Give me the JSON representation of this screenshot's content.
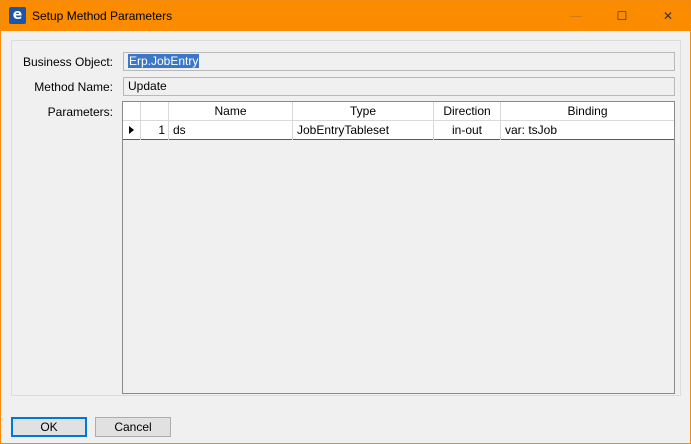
{
  "window": {
    "title": "Setup Method Parameters",
    "app_icon_letter": "e",
    "minimize_glyph": "—",
    "maximize_glyph": "☐",
    "close_glyph": "✕",
    "accent_color": "#fb8c00"
  },
  "form": {
    "business_object_label": "Business Object:",
    "business_object_value": "Erp.JobEntry",
    "method_name_label": "Method Name:",
    "method_name_value": "Update",
    "parameters_label": "Parameters:"
  },
  "grid": {
    "columns": [
      "",
      "",
      "Name",
      "Type",
      "Direction",
      "Binding"
    ],
    "rows": [
      {
        "indicator": "row-selector-arrow-icon",
        "index": "1",
        "name": "ds",
        "type": "JobEntryTableset",
        "direction": "in-out",
        "binding": "var: tsJob"
      }
    ]
  },
  "buttons": {
    "ok": "OK",
    "cancel": "Cancel"
  }
}
